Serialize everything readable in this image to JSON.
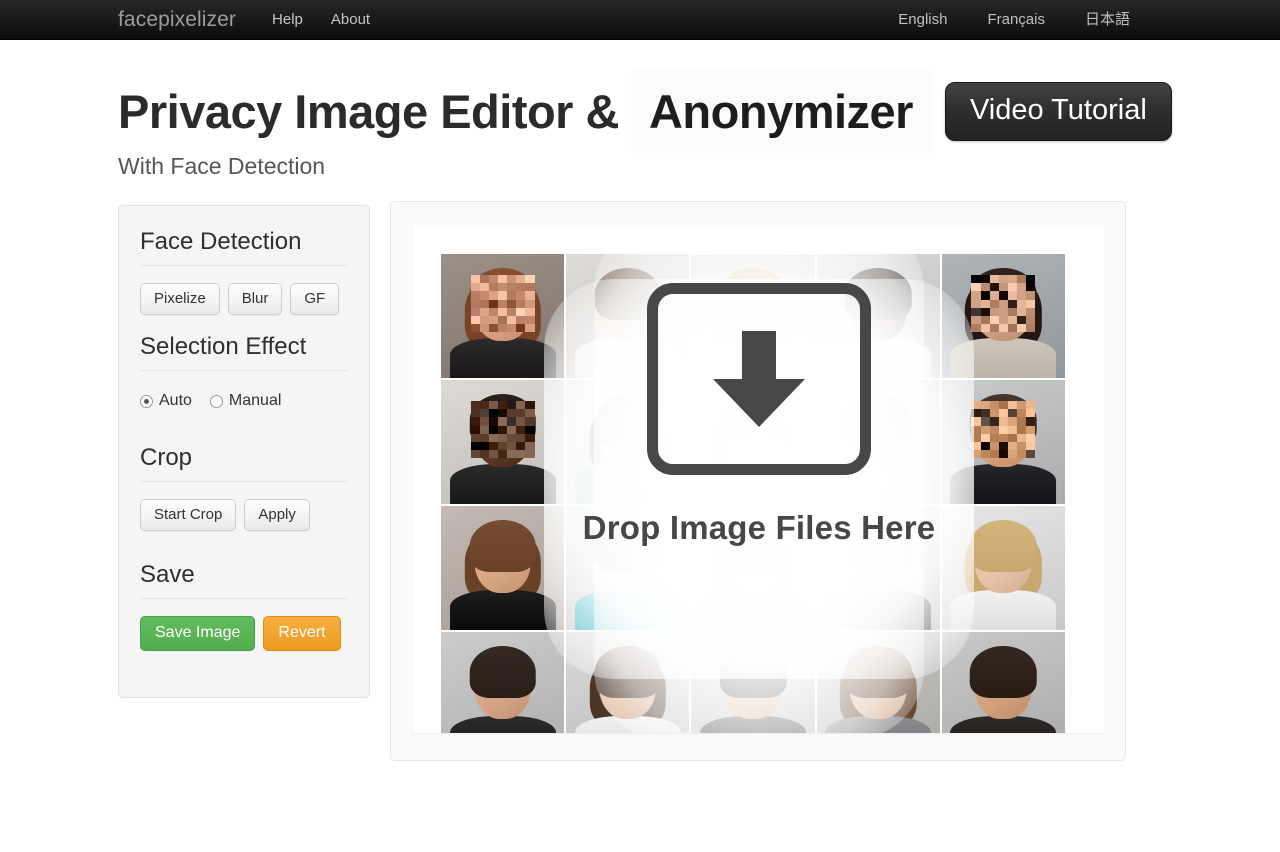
{
  "navbar": {
    "brand": "facepixelizer",
    "links": [
      {
        "label": "Help",
        "name": "nav-link-help"
      },
      {
        "label": "About",
        "name": "nav-link-about"
      }
    ],
    "languages": [
      {
        "label": "English"
      },
      {
        "label": "Français"
      },
      {
        "label": "日本語"
      }
    ]
  },
  "hero": {
    "title": "Privacy Image Editor &",
    "rotating_word": "Anonymizer",
    "video_button": "Video Tutorial",
    "subtitle": "With Face Detection"
  },
  "sidebar": {
    "sections": [
      {
        "heading": "Face Detection",
        "buttons": [
          "Pixelize",
          "Blur",
          "GF"
        ]
      },
      {
        "heading": "Selection Effect",
        "radios": [
          {
            "label": "Auto",
            "selected": true
          },
          {
            "label": "Manual",
            "selected": false
          }
        ]
      },
      {
        "heading": "Crop",
        "buttons": [
          "Start Crop",
          "Apply"
        ]
      },
      {
        "heading": "Save",
        "buttons": [
          "Save Image",
          "Revert"
        ]
      }
    ]
  },
  "canvas": {
    "dropzone_text": "Drop Image Files Here",
    "dropzone_icon": "down-arrow-icon"
  },
  "colors": {
    "navbar_bg": "#191919",
    "save_green": "#53ad4f",
    "revert_orange": "#ef9b23",
    "dropzone_gray": "#474747",
    "panel_bg": "#f5f5f5",
    "title_text": "#2b2b2b"
  },
  "photo_grid": {
    "columns": 5,
    "rows": 4,
    "cells": [
      {
        "skin": "#d9a287",
        "hair": "#7b4326",
        "hairstyle": "long",
        "cloth": "#2c2a2a",
        "bg": "#8d8177",
        "pixelized": true
      },
      {
        "skin": "#d8b69f",
        "hair": "#6b5542",
        "hairstyle": "short",
        "cloth": "#f2f2f2",
        "bg": "#cfcbc6",
        "pixelized": false
      },
      {
        "skin": "#e2bda4",
        "hair": "#b79664",
        "hairstyle": "long",
        "cloth": "#ededed",
        "bg": "#cdcdcd",
        "pixelized": false
      },
      {
        "skin": "#6d4a34",
        "hair": "#241a15",
        "hairstyle": "short",
        "cloth": "#efefef",
        "bg": "#c9c9c9",
        "pixelized": false
      },
      {
        "skin": "#cfa084",
        "hair": "#241712",
        "hairstyle": "long",
        "cloth": "#cfc6bb",
        "bg": "#9fa4a8",
        "pixelized": true
      },
      {
        "skin": "#5a3b28",
        "hair": "#201410",
        "hairstyle": "short",
        "cloth": "#2a2a2a",
        "bg": "#cdc9c4",
        "pixelized": true
      },
      {
        "skin": "#e0bba2",
        "hair": "#5e4a3a",
        "hairstyle": "long",
        "cloth": "#9cc0cb",
        "bg": "#d5d2cd",
        "pixelized": false
      },
      {
        "skin": "#e3c0a7",
        "hair": "#7a5a3f",
        "hairstyle": "long",
        "cloth": "#e8e8e8",
        "bg": "#cfcfcf",
        "pixelized": false
      },
      {
        "skin": "#dfb99e",
        "hair": "#4a3b30",
        "hairstyle": "short",
        "cloth": "#dcdcdc",
        "bg": "#c7c7c7",
        "pixelized": false
      },
      {
        "skin": "#d9a178",
        "hair": "#3a2a20",
        "hairstyle": "short",
        "cloth": "#26262a",
        "bg": "#b7b9bb",
        "pixelized": true
      },
      {
        "skin": "#d7a783",
        "hair": "#6a4126",
        "hairstyle": "long",
        "cloth": "#1d1d1d",
        "bg": "#b3aaa2",
        "pixelized": false
      },
      {
        "skin": "#dcb69c",
        "hair": "#4b3a2c",
        "hairstyle": "short",
        "cloth": "#19b0c4",
        "bg": "#c8c6c2",
        "pixelized": false
      },
      {
        "skin": "#dfb79b",
        "hair": "#3a2b22",
        "hairstyle": "long",
        "cloth": "#d8323c",
        "bg": "#cbc9c6",
        "pixelized": false
      },
      {
        "skin": "#d4b39c",
        "hair": "#9a9a95",
        "hairstyle": "short",
        "cloth": "#38383c",
        "bg": "#c4c2be",
        "pixelized": false
      },
      {
        "skin": "#e6c2a6",
        "hair": "#c8a86e",
        "hairstyle": "long",
        "cloth": "#f1f1f1",
        "bg": "#d6d6d6",
        "pixelized": false
      },
      {
        "skin": "#d5a486",
        "hair": "#2a1d16",
        "hairstyle": "short",
        "cloth": "#2b2b2b",
        "bg": "#bcbcbc",
        "pixelized": false
      },
      {
        "skin": "#e0b89c",
        "hair": "#4b3527",
        "hairstyle": "long",
        "cloth": "#f0f0f0",
        "bg": "#c9c9c9",
        "pixelized": false
      },
      {
        "skin": "#d9ab86",
        "hair": "#211711",
        "hairstyle": "short",
        "cloth": "#3a3a3a",
        "bg": "#bdbdbd",
        "pixelized": false
      },
      {
        "skin": "#dfb79c",
        "hair": "#6a4a31",
        "hairstyle": "long",
        "cloth": "#8a8a8e",
        "bg": "#b9b7b4",
        "pixelized": false
      },
      {
        "skin": "#d2a07c",
        "hair": "#2a1c14",
        "hairstyle": "short",
        "cloth": "#2e2a28",
        "bg": "#b8b8b8",
        "pixelized": false
      }
    ]
  }
}
